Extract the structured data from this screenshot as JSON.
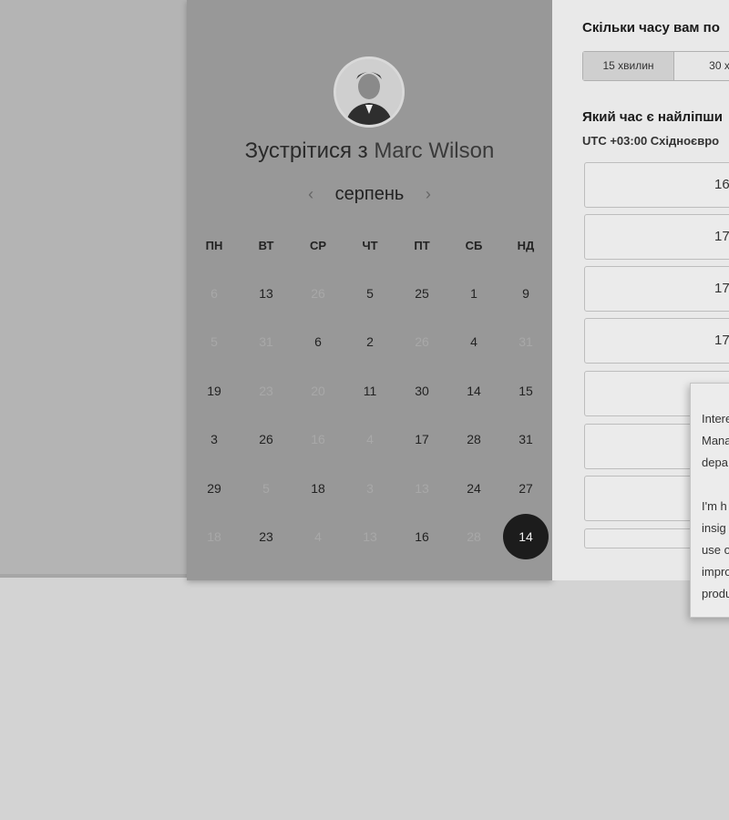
{
  "host": {
    "title_prefix": "Зустрітися з",
    "name": "Marc Wilson"
  },
  "calendar": {
    "month": "серпень",
    "prev_icon": "‹",
    "next_icon": "›",
    "weekdays": [
      "ПН",
      "ВТ",
      "СР",
      "ЧТ",
      "ПТ",
      "СБ",
      "НД"
    ],
    "weeks": [
      [
        "6",
        "13",
        "26",
        "5",
        "25",
        "1",
        "9"
      ],
      [
        "5",
        "31",
        "6",
        "2",
        "26",
        "4",
        "31"
      ],
      [
        "19",
        "23",
        "20",
        "11",
        "30",
        "14",
        "15"
      ],
      [
        "3",
        "26",
        "16",
        "4",
        "17",
        "28",
        "31"
      ],
      [
        "29",
        "5",
        "18",
        "3",
        "13",
        "24",
        "27"
      ],
      [
        "18",
        "23",
        "4",
        "13",
        "16",
        "28",
        "14"
      ]
    ],
    "muted": [
      [
        true,
        false,
        true,
        false,
        false,
        false,
        false
      ],
      [
        true,
        true,
        false,
        false,
        true,
        false,
        true
      ],
      [
        false,
        true,
        true,
        false,
        false,
        false,
        false
      ],
      [
        false,
        false,
        true,
        true,
        false,
        false,
        false
      ],
      [
        false,
        true,
        false,
        true,
        true,
        false,
        false
      ],
      [
        true,
        false,
        true,
        true,
        false,
        true,
        false
      ]
    ],
    "selected": {
      "week": 5,
      "day": 6
    }
  },
  "booking": {
    "duration_question": "Скільки часу вам по",
    "durations": [
      "15 хвилин",
      "30 х"
    ],
    "active_duration": 0,
    "time_question": "Який час є найліпши",
    "timezone": "UTC +03:00 Східноєвро",
    "slots": [
      "16",
      "17",
      "17",
      "17",
      "",
      "",
      "",
      ""
    ]
  },
  "popover": {
    "lines": [
      "Intere",
      "Mana",
      "depa",
      "",
      "I'm h",
      "insig",
      "use o",
      "impro",
      "produ"
    ]
  },
  "colors": {
    "selected_day_bg": "#1c1c1c",
    "calendar_bg": "#989898"
  }
}
